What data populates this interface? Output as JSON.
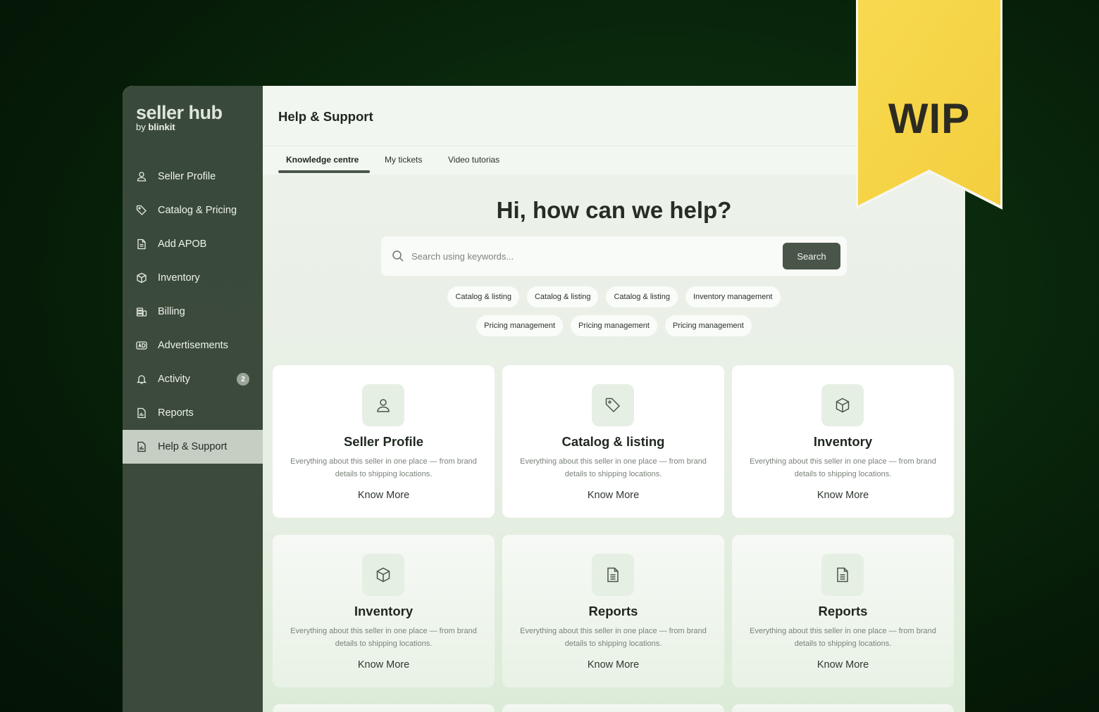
{
  "brand": {
    "name": "seller hub",
    "by": "by",
    "sub": "blinkit"
  },
  "sidebar": {
    "items": [
      {
        "label": "Seller Profile",
        "icon": "user-icon"
      },
      {
        "label": "Catalog & Pricing",
        "icon": "tag-icon"
      },
      {
        "label": "Add APOB",
        "icon": "document-icon"
      },
      {
        "label": "Inventory",
        "icon": "box-icon"
      },
      {
        "label": "Billing",
        "icon": "coins-icon"
      },
      {
        "label": "Advertisements",
        "icon": "ad-icon"
      },
      {
        "label": "Activity",
        "icon": "bell-icon",
        "badge": "2"
      },
      {
        "label": "Reports",
        "icon": "report-icon"
      },
      {
        "label": "Help & Support",
        "icon": "help-report-icon",
        "active": true
      }
    ]
  },
  "header": {
    "title": "Help & Support"
  },
  "tabs": [
    {
      "label": "Knowledge centre",
      "active": true
    },
    {
      "label": "My tickets"
    },
    {
      "label": "Video tutorias"
    }
  ],
  "hero": {
    "title": "Hi, how can we help?"
  },
  "search": {
    "placeholder": "Search using keywords...",
    "button": "Search"
  },
  "chips": {
    "row1": [
      "Catalog & listing",
      "Catalog & listing",
      "Catalog & listing",
      "Inventory management"
    ],
    "row2": [
      "Pricing management",
      "Pricing management",
      "Pricing management"
    ]
  },
  "cards": [
    {
      "title": "Seller Profile",
      "desc": "Everything about this seller in one place — from brand details to shipping locations.",
      "link": "Know More",
      "icon": "user-icon"
    },
    {
      "title": "Catalog & listing",
      "desc": "Everything about this seller in one place — from brand details to shipping locations.",
      "link": "Know More",
      "icon": "tag-icon"
    },
    {
      "title": "Inventory",
      "desc": "Everything about this seller in one place — from brand details to shipping locations.",
      "link": "Know More",
      "icon": "box-icon"
    },
    {
      "title": "Inventory",
      "desc": "Everything about this seller in one place — from brand details to shipping locations.",
      "link": "Know More",
      "icon": "box-icon"
    },
    {
      "title": "Reports",
      "desc": "Everything about this seller in one place — from brand details to shipping locations.",
      "link": "Know More",
      "icon": "document-icon"
    },
    {
      "title": "Reports",
      "desc": "Everything about this seller in one place — from brand details to shipping locations.",
      "link": "Know More",
      "icon": "document-icon"
    }
  ],
  "ribbon": {
    "text": "WIP",
    "color": "#f7d64a"
  },
  "colors": {
    "sidebar": "#3b4a3b",
    "accent": "#485548",
    "active_nav": "#c6cec4"
  }
}
